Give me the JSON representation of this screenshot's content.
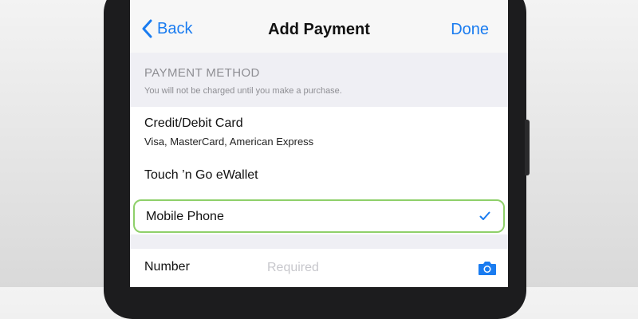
{
  "navbar": {
    "back_label": "Back",
    "title": "Add Payment",
    "done_label": "Done"
  },
  "section": {
    "title": "PAYMENT METHOD",
    "subtitle": "You will not be charged until you make a purchase."
  },
  "payment_options": [
    {
      "label": "Credit/Debit Card",
      "subtitle": "Visa, MasterCard, American Express",
      "selected": false
    },
    {
      "label": "Touch ’n Go eWallet",
      "selected": false
    },
    {
      "label": "Mobile Phone",
      "selected": true
    }
  ],
  "number_field": {
    "label": "Number",
    "placeholder": "Required",
    "value": ""
  },
  "colors": {
    "accent": "#1a7cf0",
    "highlight": "#8fd06a",
    "section_bg": "#efeff4"
  },
  "icons": [
    "chevron-left-icon",
    "checkmark-icon",
    "camera-icon"
  ]
}
